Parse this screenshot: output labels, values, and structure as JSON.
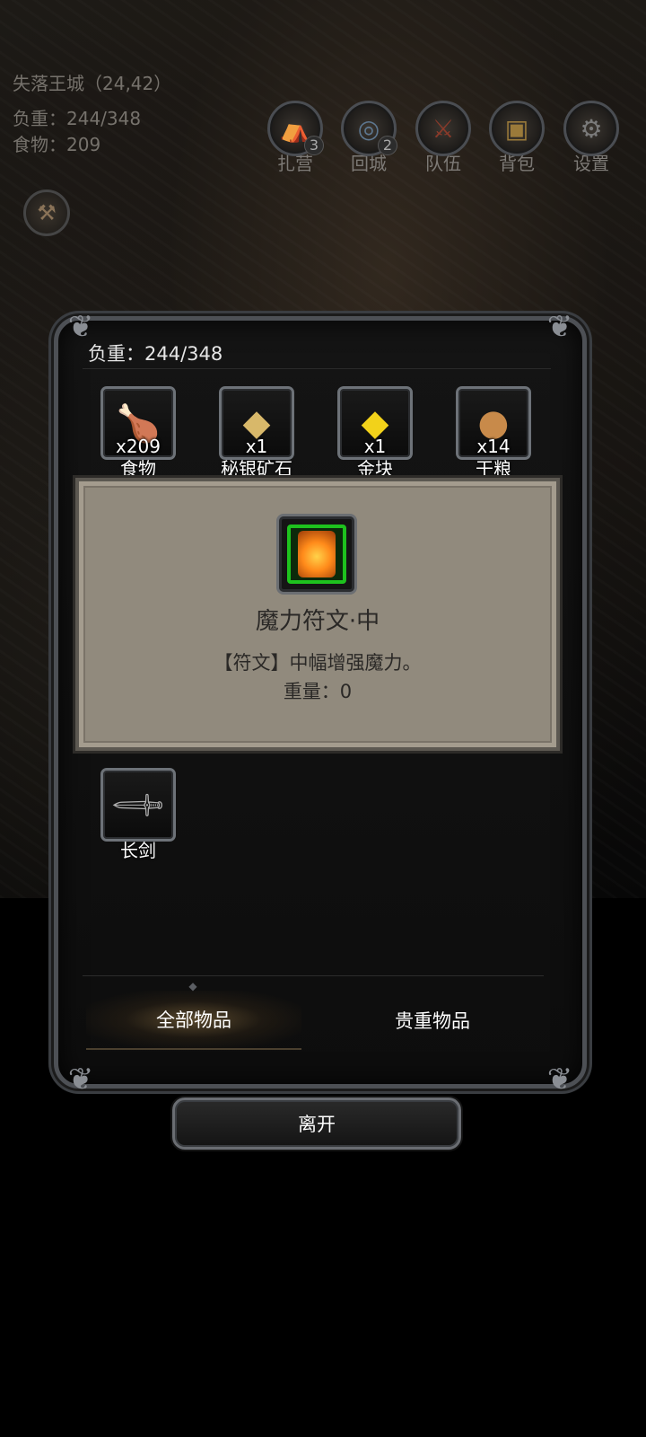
{
  "hud": {
    "location": "失落王城（24,42）",
    "load": "负重：244/348",
    "food": "食物：209"
  },
  "top_buttons": [
    {
      "label": "扎营",
      "badge": "3",
      "icon": "camp-icon"
    },
    {
      "label": "回城",
      "badge": "2",
      "icon": "portal-icon"
    },
    {
      "label": "队伍",
      "badge": "",
      "icon": "team-icon"
    },
    {
      "label": "背包",
      "badge": "",
      "icon": "backpack-icon"
    },
    {
      "label": "设置",
      "badge": "",
      "icon": "gear-icon"
    }
  ],
  "inventory": {
    "load": "负重：244/348",
    "items": [
      {
        "name": "食物",
        "qty": "x209",
        "icon": "meat-icon"
      },
      {
        "name": "秘银矿石",
        "qty": "x1",
        "icon": "mithril-ore-icon"
      },
      {
        "name": "金块",
        "qty": "x1",
        "icon": "gold-nugget-icon"
      },
      {
        "name": "干粮",
        "qty": "x14",
        "icon": "biscuit-icon"
      },
      {
        "name": "长剑",
        "qty": "",
        "icon": "longsword-icon"
      }
    ],
    "tooltip": {
      "title": "魔力符文·中",
      "description": "【符文】中幅增强魔力。",
      "weight": "重量：0",
      "icon": "rune-icon",
      "border_color": "#1ec21e"
    },
    "tabs": [
      {
        "label": "全部物品",
        "active": true
      },
      {
        "label": "贵重物品",
        "active": false
      }
    ],
    "exit_label": "离开"
  }
}
